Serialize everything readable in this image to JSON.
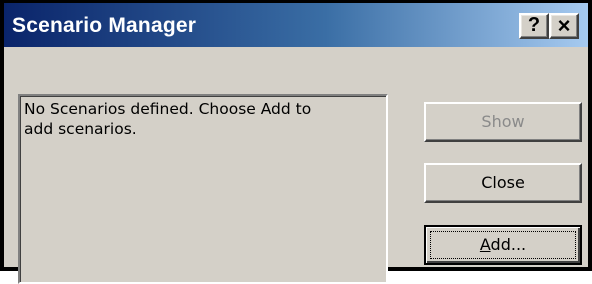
{
  "window": {
    "title": "Scenario Manager",
    "help_glyph": "?",
    "close_glyph": "×"
  },
  "scenario_list": {
    "message": "No Scenarios defined. Choose Add to\nadd scenarios."
  },
  "buttons": {
    "show": {
      "label": "Show",
      "enabled": false
    },
    "close": {
      "label": "Close",
      "enabled": true
    },
    "add": {
      "label_mnemonic": "A",
      "label_rest": "dd...",
      "enabled": true,
      "focused": true
    }
  }
}
